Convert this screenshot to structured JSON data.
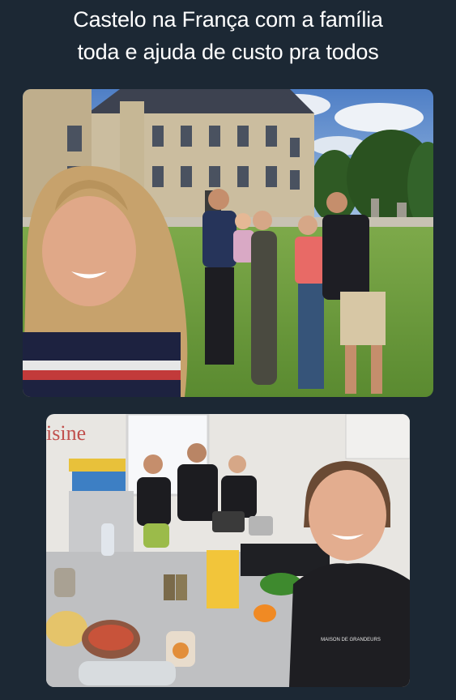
{
  "caption": {
    "line1": "Castelo na França com a família",
    "line2": "toda e ajuda de custo pra todos"
  },
  "photos": [
    {
      "subject": "family-at-castle-photo"
    },
    {
      "subject": "cooking-class-kitchen-photo",
      "sign_text": "isine",
      "shirt_logo_text": "MAISON DE GRANDEURS"
    }
  ],
  "colors": {
    "background": "#1c2834",
    "caption_text": "#ffffff",
    "sign_red": "#c0504d"
  }
}
